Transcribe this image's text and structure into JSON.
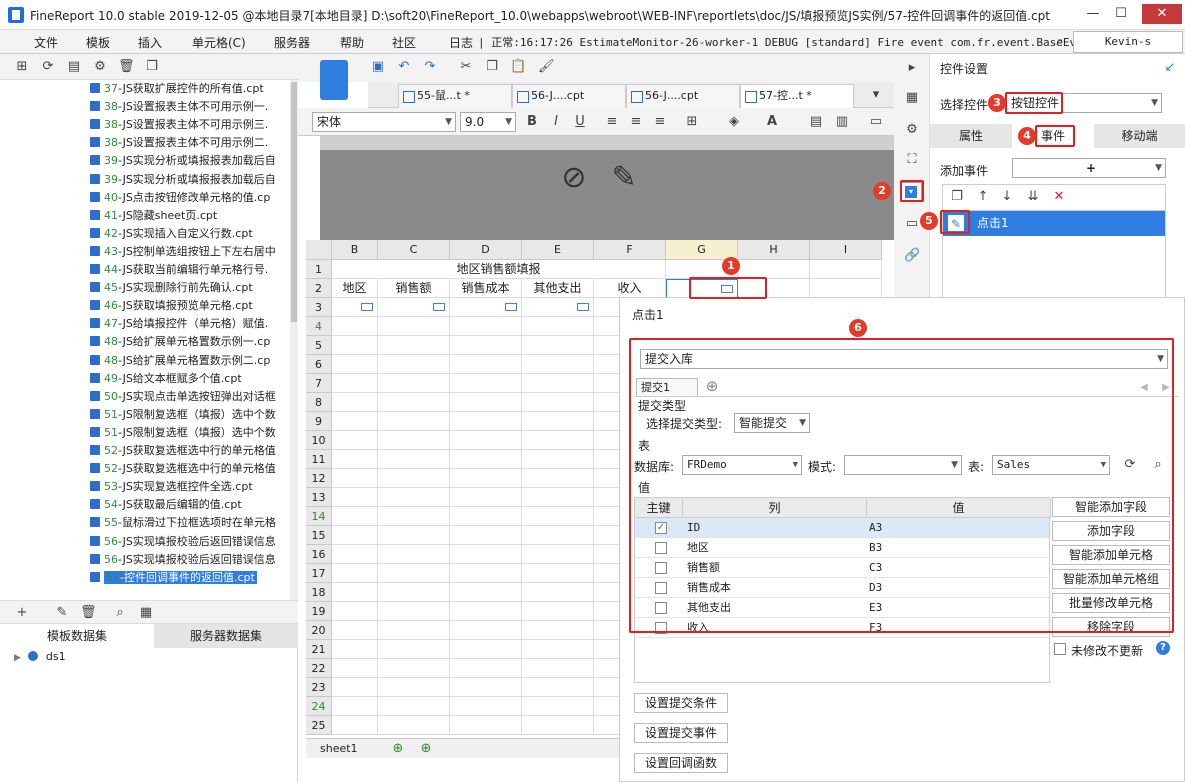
{
  "window": {
    "title": "FineReport 10.0 stable 2019-12-05 @本地目录7[本地目录]   D:\\soft20\\FineReport_10.0\\webapps\\webroot\\WEB-INF\\reportlets\\doc/JS/填报预览JS实例/57-控件回调事件的返回值.cpt"
  },
  "menu": [
    "文件",
    "模板",
    "插入",
    "单元格(C)",
    "服务器",
    "帮助",
    "社区"
  ],
  "log": {
    "label": "日志",
    "text": "| 正常:16:17:26 EstimateMonitor-26-worker-1 DEBUG [standard] Fire event com.fr.event.BaseEve..."
  },
  "user": "Kevin-s",
  "files": [
    {
      "num": "37",
      "name": "-JS获取扩展控件的所有值.cpt"
    },
    {
      "num": "38",
      "name": "-JS设置报表主体不可用示例一."
    },
    {
      "num": "38",
      "name": "-JS设置报表主体不可用示例三."
    },
    {
      "num": "38",
      "name": "-JS设置报表主体不可用示例二."
    },
    {
      "num": "39",
      "name": "-JS实现分析或填报报表加载后自"
    },
    {
      "num": "39",
      "name": "-JS实现分析或填报报表加载后自"
    },
    {
      "num": "40",
      "name": "-JS点击按钮修改单元格的值.cp"
    },
    {
      "num": "41",
      "name": "-JS隐藏sheet页.cpt"
    },
    {
      "num": "42",
      "name": "-JS实现插入自定义行数.cpt"
    },
    {
      "num": "43",
      "name": "-JS控制单选组按钮上下左右居中"
    },
    {
      "num": "44",
      "name": "-JS获取当前编辑行单元格行号."
    },
    {
      "num": "45",
      "name": "-JS实现删除行前先确认.cpt"
    },
    {
      "num": "46",
      "name": "-JS获取填报预览单元格.cpt"
    },
    {
      "num": "47",
      "name": "-JS给填报控件（单元格）赋值."
    },
    {
      "num": "48",
      "name": "-JS给扩展单元格置数示例一.cp"
    },
    {
      "num": "48",
      "name": "-JS给扩展单元格置数示例二.cp"
    },
    {
      "num": "49",
      "name": "-JS给文本框赋多个值.cpt"
    },
    {
      "num": "50",
      "name": "-JS实现点击单选按钮弹出对话框"
    },
    {
      "num": "51",
      "name": "-JS限制复选框（填报）选中个数"
    },
    {
      "num": "51",
      "name": "-JS限制复选框（填报）选中个数"
    },
    {
      "num": "52",
      "name": "-JS获取复选框选中行的单元格值"
    },
    {
      "num": "52",
      "name": "-JS获取复选框选中行的单元格值"
    },
    {
      "num": "53",
      "name": "-JS实现复选框控件全选.cpt"
    },
    {
      "num": "54",
      "name": "-JS获取最后编辑的值.cpt"
    },
    {
      "num": "55",
      "name": "-鼠标滑过下拉框选项时在单元格"
    },
    {
      "num": "56",
      "name": "-JS实现填报校验后返回错误信息"
    },
    {
      "num": "56",
      "name": "-JS实现填报校验后返回错误信息"
    },
    {
      "num": "57",
      "name": "-控件回调事件的返回值.cpt"
    }
  ],
  "dataset_tabs": [
    "模板数据集",
    "服务器数据集"
  ],
  "dataset_item": "ds1",
  "tabs": [
    "55-鼠...t *",
    "56-J....cpt",
    "56-J....cpt",
    "57-控...t *"
  ],
  "font": {
    "name": "宋体",
    "size": "9.0"
  },
  "columns": [
    "B",
    "C",
    "D",
    "E",
    "F",
    "G",
    "H",
    "I"
  ],
  "rows": [
    "1",
    "2",
    "3",
    "4",
    "5",
    "6",
    "7",
    "8",
    "9",
    "10",
    "11",
    "12",
    "13",
    "14",
    "15",
    "16",
    "17",
    "18",
    "19",
    "20",
    "21",
    "22",
    "23",
    "24",
    "25"
  ],
  "sheet": {
    "title": "地区销售额填报",
    "headers": [
      "地区",
      "销售额",
      "销售成本",
      "其他支出",
      "收入"
    ]
  },
  "sheet_tab": "sheet1",
  "right_panel": {
    "title": "控件设置",
    "select_label": "选择控件",
    "select_value": "按钮控件",
    "tabs": [
      "属性",
      "事件",
      "移动端"
    ],
    "add_event": "添加事件",
    "event_item": "点击1"
  },
  "dialog": {
    "title": "点击1",
    "action": "提交入库",
    "sub_tab": "提交1",
    "submit_type_section": "提交类型",
    "submit_type_label": "选择提交类型:",
    "submit_type_value": "智能提交",
    "table_section": "表",
    "db_label": "数据库:",
    "db_value": "FRDemo",
    "mode_label": "模式:",
    "mode_value": "",
    "table_label": "表:",
    "table_value": "Sales",
    "value_section": "值",
    "col_headers": [
      "主键",
      "列",
      "值"
    ],
    "fields": [
      {
        "key": true,
        "col": "ID",
        "val": "A3"
      },
      {
        "key": false,
        "col": "地区",
        "val": "B3"
      },
      {
        "key": false,
        "col": "销售额",
        "val": "C3"
      },
      {
        "key": false,
        "col": "销售成本",
        "val": "D3"
      },
      {
        "key": false,
        "col": "其他支出",
        "val": "E3"
      },
      {
        "key": false,
        "col": "收入",
        "val": "F3"
      }
    ],
    "side_buttons": [
      "智能添加字段",
      "添加字段",
      "智能添加单元格",
      "智能添加单元格组",
      "批量修改单元格",
      "移除字段"
    ],
    "unmodified_label": "未修改不更新",
    "bottom_buttons": [
      "设置提交条件",
      "设置提交事件",
      "设置回调函数"
    ]
  },
  "badges": [
    "1",
    "2",
    "3",
    "4",
    "5",
    "6"
  ],
  "colors": {
    "accent": "#2f7de1",
    "highlight": "#e02020"
  }
}
